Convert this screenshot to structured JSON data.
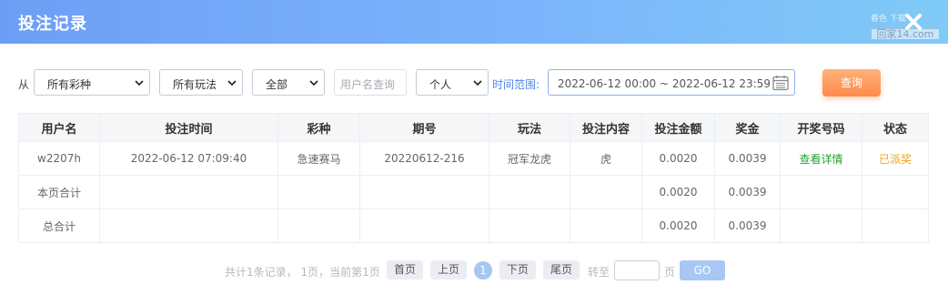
{
  "header": {
    "title": "投注记录",
    "watermark_top": "春色 下载",
    "watermark_bottom": "回家14.com"
  },
  "filters": {
    "from_label": "从",
    "lottery_select": "所有彩种",
    "play_select": "所有玩法",
    "all_select": "全部",
    "username_placeholder": "用户名查询",
    "scope_select": "个人",
    "range_label": "时间范围:",
    "date_range": "2022-06-12 00:00 ~ 2022-06-12 23:59",
    "query_button": "查询"
  },
  "table": {
    "columns": [
      "用户名",
      "投注时间",
      "彩种",
      "期号",
      "玩法",
      "投注内容",
      "投注金额",
      "奖金",
      "开奖号码",
      "状态"
    ],
    "rows": [
      {
        "username": "w2207h",
        "bet_time": "2022-06-12 07:09:40",
        "lottery": "急速赛马",
        "issue": "20220612-216",
        "play": "冠军龙虎",
        "content": "虎",
        "amount": "0.0020",
        "prize": "0.0039",
        "draw_numbers": "查看详情",
        "status": "已派奖"
      }
    ],
    "page_total": {
      "label": "本页合计",
      "amount": "0.0020",
      "prize": "0.0039"
    },
    "grand_total": {
      "label": "总合计",
      "amount": "0.0020",
      "prize": "0.0039"
    }
  },
  "pagination": {
    "summary": "共计1条记录，  1页，当前第1页",
    "first": "首页",
    "prev": "上页",
    "current": "1",
    "next": "下页",
    "last": "尾页",
    "goto_label": "转至",
    "page_label": "页",
    "go": "GO"
  },
  "colors": {
    "header_gradient_start": "#6d9ef5",
    "header_gradient_end": "#7fcaf7",
    "query_button": "#ff8a4c",
    "link_green": "#23a236",
    "status_orange": "#f2a40c",
    "accent_blue": "#4f86e8"
  },
  "icons": {
    "close": "close-icon",
    "calendar": "calendar-icon",
    "chevron": "chevron-down-icon"
  }
}
